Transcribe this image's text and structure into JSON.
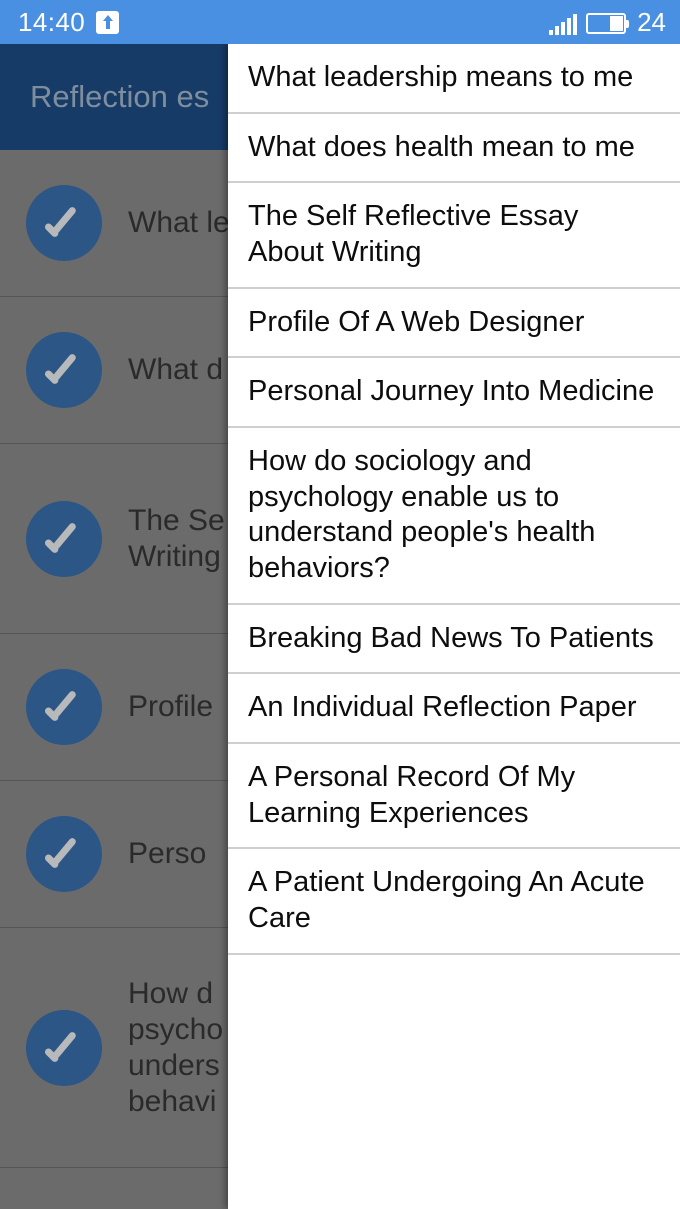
{
  "status_bar": {
    "clock": "14:40",
    "battery_level": "24",
    "upload_icon": "upload-arrow-icon",
    "signal_icon": "signal-bars-icon",
    "battery_icon": "battery-icon",
    "background_color": "#4a90e2"
  },
  "app_bar": {
    "title": "Reflection es",
    "background_color": "#163b66",
    "title_color": "#7f8e9e"
  },
  "background_list": {
    "scrim_color": "#6b6b6b",
    "check_icon_color": "#2c5686",
    "items": [
      {
        "icon": "check-circle-icon",
        "label": "What le",
        "height_class": "h1"
      },
      {
        "icon": "check-circle-icon",
        "label": "What d",
        "height_class": "h1"
      },
      {
        "icon": "check-circle-icon",
        "label": "The Se\nWriting",
        "height_class": "h2"
      },
      {
        "icon": "check-circle-icon",
        "label": "Profile",
        "height_class": "h1"
      },
      {
        "icon": "check-circle-icon",
        "label": "Perso",
        "height_class": "h1"
      },
      {
        "icon": "check-circle-icon",
        "label": "How d\npsycho\nunders\nbehavi",
        "height_class": "h3"
      }
    ]
  },
  "dropdown_menu": {
    "background_color": "#ffffff",
    "divider_color": "#cfcfcf",
    "text_color": "#0d0d0d",
    "items": [
      {
        "label": "What leadership means to me"
      },
      {
        "label": "What does health mean to me"
      },
      {
        "label": "The Self Reflective Essay About Writing"
      },
      {
        "label": "Profile Of  A Web Designer"
      },
      {
        "label": "Personal Journey Into Medicine"
      },
      {
        "label": "How do sociology and psychology enable us to understand people's health behaviors?"
      },
      {
        "label": "Breaking Bad News To Patients"
      },
      {
        "label": "An Individual Reflection Paper"
      },
      {
        "label": "A Personal Record Of My Learning Experiences"
      },
      {
        "label": "A Patient Undergoing An Acute Care"
      }
    ]
  }
}
